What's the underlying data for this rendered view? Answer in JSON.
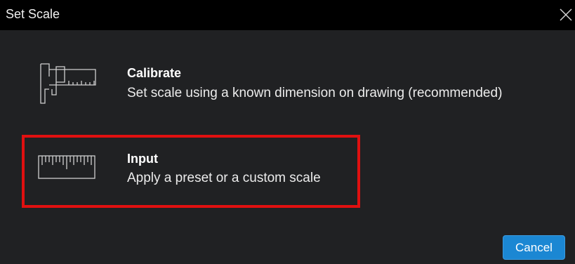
{
  "dialog": {
    "title": "Set Scale",
    "close_icon": "close-icon"
  },
  "options": [
    {
      "title": "Calibrate",
      "description": "Set scale using a known dimension on drawing (recommended)",
      "icon": "caliper-icon"
    },
    {
      "title": "Input",
      "description": "Apply a preset or a custom scale",
      "icon": "ruler-icon",
      "highlight_color": "#e01010"
    }
  ],
  "footer": {
    "cancel_label": "Cancel"
  },
  "colors": {
    "background": "#202123",
    "titlebar": "#000000",
    "accent": "#1b87d3"
  }
}
